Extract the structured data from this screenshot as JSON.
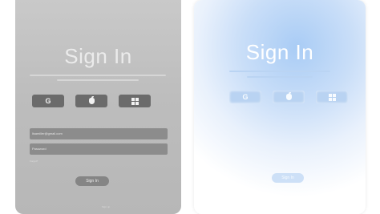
{
  "gray_panel": {
    "title": "Sign In",
    "social_buttons": [
      {
        "icon": "google-icon",
        "label": "G"
      },
      {
        "icon": "apple-icon",
        "label": ""
      },
      {
        "icon": "windows-icon",
        "label": ""
      }
    ],
    "email_value": "lisamiller@gmail.com",
    "password_placeholder": "Password",
    "forgot_label": "Forgot?",
    "signin_label": "Sign In",
    "footer_text": "Sign up"
  },
  "blue_panel": {
    "title": "Sign In",
    "social_buttons": [
      {
        "icon": "google-icon",
        "label": "G"
      },
      {
        "icon": "apple-icon",
        "label": ""
      },
      {
        "icon": "windows-icon",
        "label": ""
      }
    ],
    "signin_label": "Sign In"
  },
  "colors": {
    "gray_bg": "#bdbdbd",
    "gray_button": "#6b6b6b",
    "blue_accent": "#a9ccf5"
  }
}
